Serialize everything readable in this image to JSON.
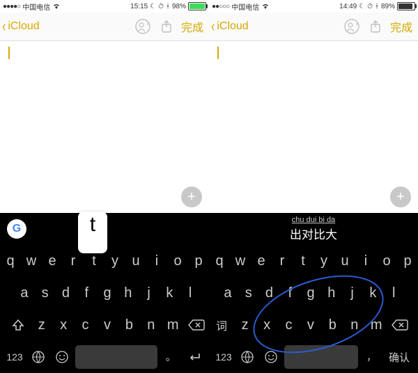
{
  "left": {
    "status": {
      "signal": "●●●●○",
      "carrier": "中国电信",
      "wifi": "wifi",
      "time": "15:15",
      "moon": "☾",
      "alarm": "⏰",
      "bt": "✱",
      "battery_pct": "98%",
      "battery_fill": 96
    },
    "nav": {
      "back": "iCloud",
      "done": "完成"
    }
  },
  "right": {
    "status": {
      "signal": "●●○○○",
      "carrier": "中国电信",
      "wifi": "wifi",
      "time": "14:49",
      "moon": "☾",
      "alarm": "⏰",
      "bt": "✱",
      "battery_pct": "89%",
      "battery_fill": 88
    },
    "nav": {
      "back": "iCloud",
      "done": "完成"
    }
  },
  "keyboard": {
    "popup_key": "t",
    "candidate_pinyin": "chu dui bi da",
    "candidate_hanzi": "出对比大",
    "row1": [
      "q",
      "w",
      "e",
      "r",
      "t",
      "y",
      "u",
      "i",
      "o",
      "p"
    ],
    "row2": [
      "a",
      "s",
      "d",
      "f",
      "g",
      "h",
      "j",
      "k",
      "l"
    ],
    "row3": [
      "z",
      "x",
      "c",
      "v",
      "b",
      "n",
      "m"
    ],
    "shift_word": "词",
    "num_key": "123",
    "comma": "，",
    "period": "。",
    "confirm": "确认"
  }
}
